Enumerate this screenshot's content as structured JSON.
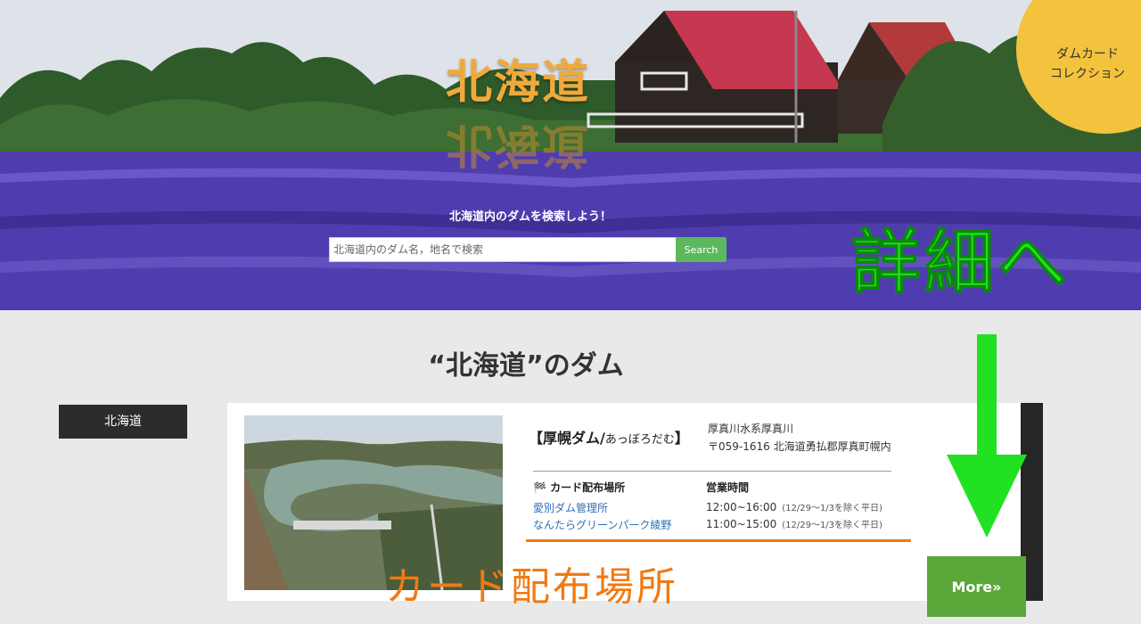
{
  "hero": {
    "title": "北海道",
    "badge_line1": "ダムカード",
    "badge_line2": "コレクション",
    "search_heading": "北海道内のダムを検索しよう！",
    "search_placeholder": "北海道内のダム名，地名で検索",
    "search_button": "Search"
  },
  "annotations": {
    "detail_label": "詳細へ",
    "card_place_label": "カード配布場所",
    "colors": {
      "green": "#22e022",
      "orange": "#f27a12"
    }
  },
  "section": {
    "title": "“北海道”のダム",
    "region_label": "北海道"
  },
  "dam": {
    "name": "【厚幌ダム/",
    "name_kana": "あっぼろだむ",
    "name_close": "】",
    "river": "厚真川水系厚真川",
    "address": "〒059-1616 北海道勇払郡厚真町幌内",
    "place_header": "🏁 カード配布場所",
    "hours_header": "営業時間",
    "places": [
      {
        "name": "愛別ダム管理所",
        "hours": "12:00~16:00",
        "note": "(12/29～1/3を除く平日)"
      },
      {
        "name": "なんたらグリーンパーク綾野",
        "hours": "11:00~15:00",
        "note": "(12/29～1/3を除く平日)"
      }
    ],
    "more_button": "More»"
  }
}
